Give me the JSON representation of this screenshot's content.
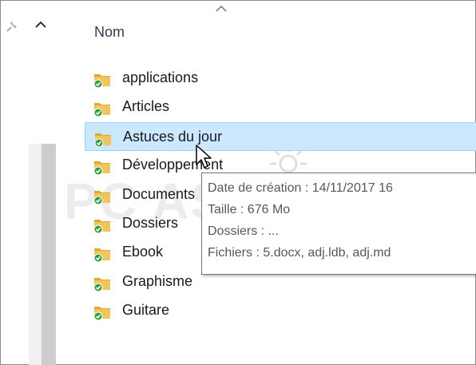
{
  "column_header": "Nom",
  "folders": [
    {
      "label": "applications",
      "icon": "shared-folder-icon"
    },
    {
      "label": "Articles",
      "icon": "shared-folder-icon"
    },
    {
      "label": "Astuces du jour",
      "icon": "shared-folder-icon",
      "selected": true
    },
    {
      "label": "Développement",
      "icon": "shared-folder-icon"
    },
    {
      "label": "Documents",
      "icon": "shared-folder-icon"
    },
    {
      "label": "Dossiers",
      "icon": "shared-folder-icon"
    },
    {
      "label": "Ebook",
      "icon": "shared-folder-icon"
    },
    {
      "label": "Graphisme",
      "icon": "shared-folder-icon"
    },
    {
      "label": "Guitare",
      "icon": "shared-folder-icon"
    }
  ],
  "tooltip": {
    "creation": "Date de création : 14/11/2017 16",
    "size": "Taille : 676 Mo",
    "folders": "Dossiers : ...",
    "files": "Fichiers : 5.docx, adj.ldb, adj.md"
  },
  "watermark": "PC ASTUCES",
  "colors": {
    "selection_bg": "#cce8ff",
    "selection_border": "#99d1ff",
    "folder_yellow": "#f2c55c",
    "sync_green": "#2e9e3a"
  }
}
